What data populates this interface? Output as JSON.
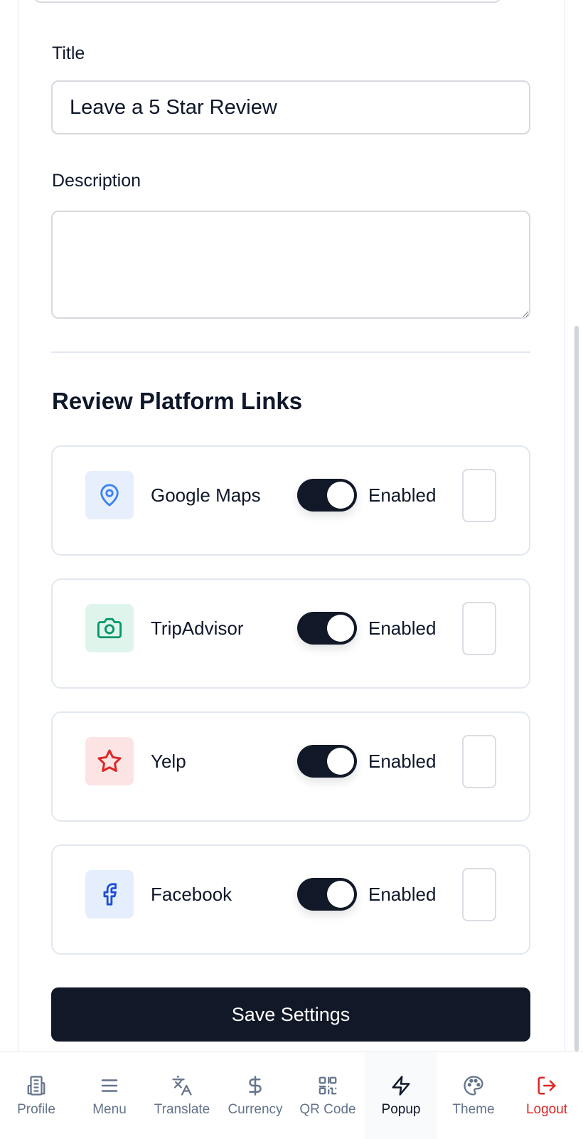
{
  "form": {
    "title_label": "Title",
    "title_value": "Leave a 5 Star Review",
    "description_label": "Description",
    "description_value": ""
  },
  "section_title": "Review Platform Links",
  "platforms": [
    {
      "name": "Google Maps",
      "icon": "map-pin-icon",
      "icon_color": "#3b82f6",
      "icon_bg": "#e7effc",
      "status": "Enabled",
      "enabled": true
    },
    {
      "name": "TripAdvisor",
      "icon": "camera-icon",
      "icon_color": "#059669",
      "icon_bg": "#dff5ec",
      "status": "Enabled",
      "enabled": true
    },
    {
      "name": "Yelp",
      "icon": "star-icon",
      "icon_color": "#dc2626",
      "icon_bg": "#fde4e4",
      "status": "Enabled",
      "enabled": true
    },
    {
      "name": "Facebook",
      "icon": "facebook-icon",
      "icon_color": "#1d4ed8",
      "icon_bg": "#e5eefc",
      "status": "Enabled",
      "enabled": true
    }
  ],
  "save_label": "Save Settings",
  "nav": [
    {
      "label": "Profile",
      "icon": "building-icon"
    },
    {
      "label": "Menu",
      "icon": "menu-icon"
    },
    {
      "label": "Translate",
      "icon": "translate-icon"
    },
    {
      "label": "Currency",
      "icon": "dollar-icon"
    },
    {
      "label": "QR Code",
      "icon": "qr-code-icon"
    },
    {
      "label": "Popup",
      "icon": "lightning-icon",
      "active": true
    },
    {
      "label": "Theme",
      "icon": "palette-icon"
    },
    {
      "label": "Logout",
      "icon": "logout-icon",
      "danger": true
    }
  ],
  "colors": {
    "primary": "#111827",
    "border": "#e2e8f0",
    "muted": "#64748b",
    "danger": "#dc2626"
  }
}
